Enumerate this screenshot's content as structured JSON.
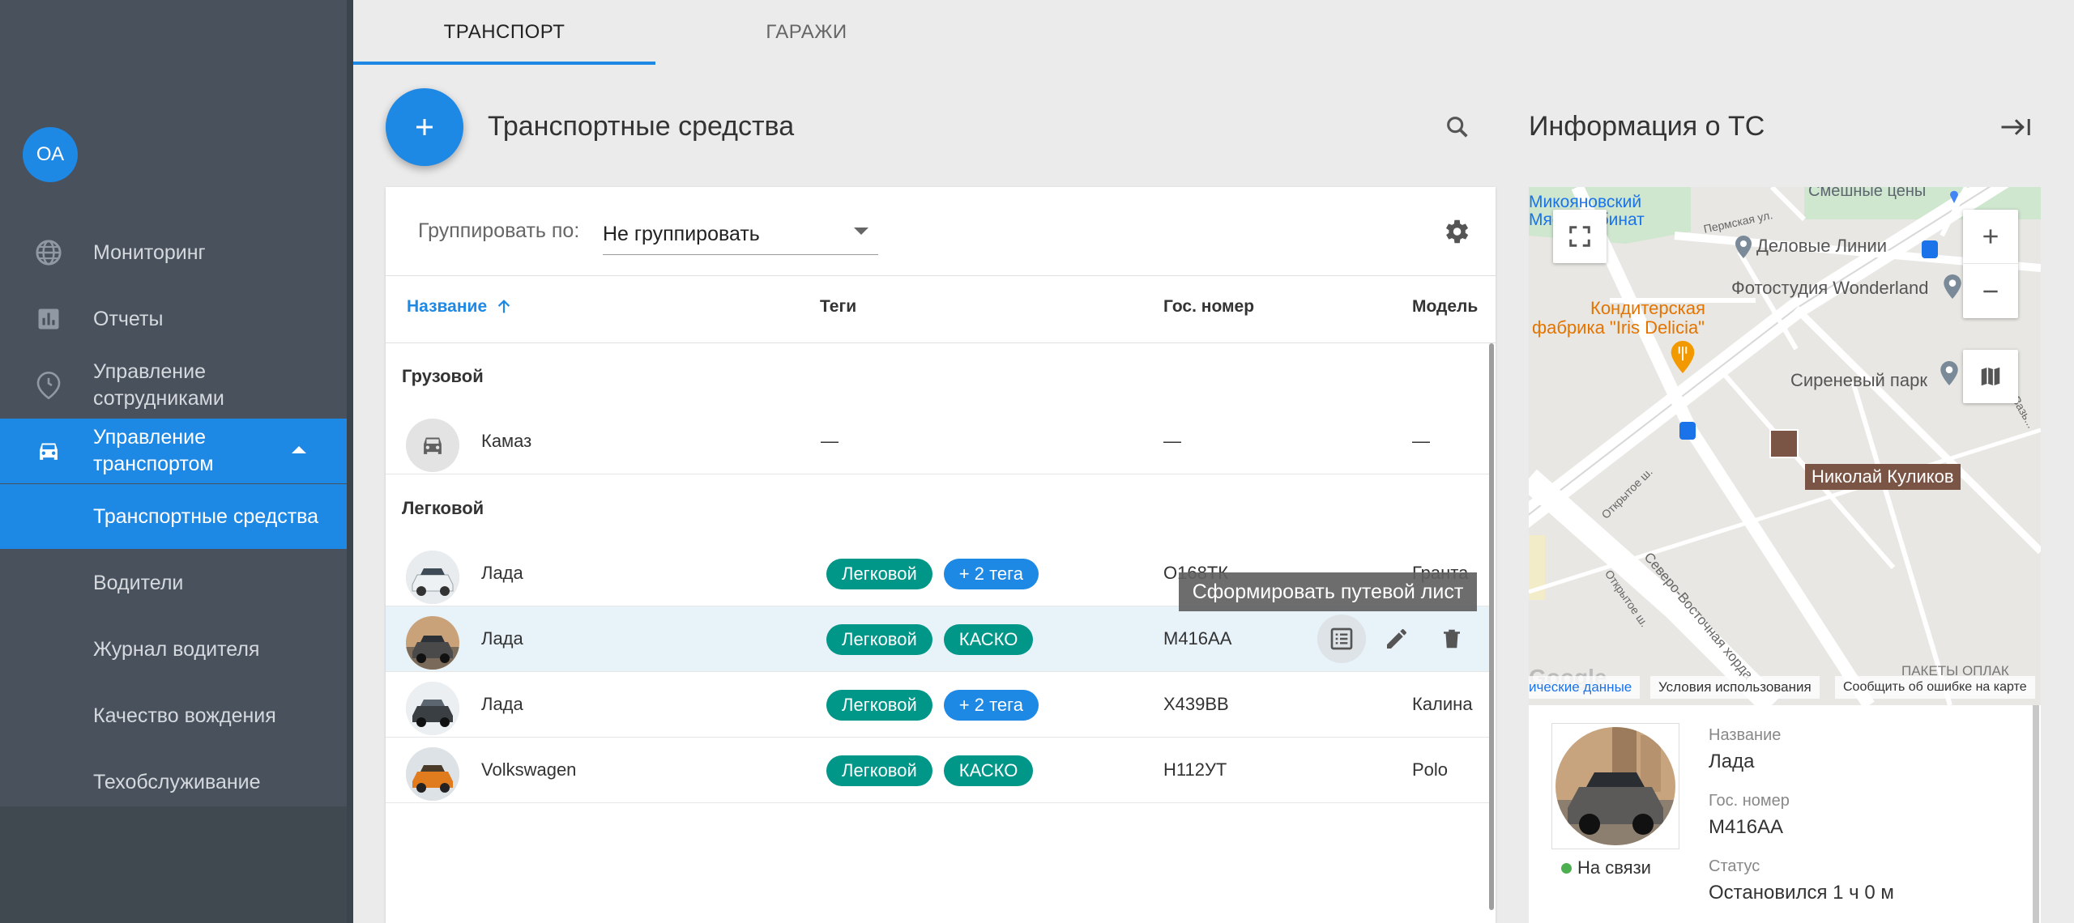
{
  "user": {
    "initials": "ОА"
  },
  "nav": {
    "monitoring": "Мониторинг",
    "reports": "Отчеты",
    "employees_line1": "Управление",
    "employees_line2": "сотрудниками",
    "transport_line1": "Управление",
    "transport_line2": "транспортом",
    "sub_items": [
      "Транспортные средства",
      "Водители",
      "Журнал водителя",
      "Качество вождения",
      "Техобслуживание"
    ]
  },
  "tabs": [
    "ТРАНСПОРТ",
    "ГАРАЖИ"
  ],
  "header": {
    "title": "Транспортные средства",
    "info_title": "Информация о ТС"
  },
  "toolbar": {
    "group_label": "Группировать по:",
    "group_value": "Не группировать"
  },
  "table": {
    "columns": [
      "Название",
      "Теги",
      "Гос. номер",
      "Модель"
    ],
    "groups": [
      {
        "title": "Грузовой",
        "rows": [
          {
            "name": "Камаз",
            "tags": "—",
            "plate": "—",
            "model": "—"
          }
        ]
      },
      {
        "title": "Легковой",
        "rows": [
          {
            "name": "Лада",
            "tag1": "Легковой",
            "tag2": "+ 2 тега",
            "plate": "О168ТК",
            "model": "Гранта"
          },
          {
            "name": "Лада",
            "tag1": "Легковой",
            "tag2": "КАСКО",
            "plate": "М416АА",
            "model": ""
          },
          {
            "name": "Лада",
            "tag1": "Легковой",
            "tag2": "+ 2 тега",
            "plate": "Х439ВВ",
            "model": "Калина"
          },
          {
            "name": "Volkswagen",
            "tag1": "Легковой",
            "tag2": "КАСКО",
            "plate": "Н112УТ",
            "model": "Polo"
          }
        ]
      }
    ],
    "tooltip": "Сформировать путевой лист"
  },
  "map": {
    "labels": {
      "kombinat": "Микояновский",
      "kombinat2": "Мясокомбинат",
      "street1": "Пермская ул.",
      "delovye": "Деловые Линии",
      "foto": "Фотостудия Wonderland",
      "konditer1": "Кондитерская",
      "konditer2": "фабрика \"Iris Delicia\"",
      "siren": "Сиреневый парк",
      "smeshnye": "Смешные цены",
      "otkrytoe": "Открытое ш.",
      "otkrytoe2": "Открытое ш.",
      "sv_hord": "Северо-Восточная хорда",
      "vaz": "Вазь...",
      "google": "Google",
      "paket": "ПАКЕТЫ ОПЛАК"
    },
    "marker_name": "Николай Куликов",
    "attribution": [
      "ические данные",
      "Условия использования",
      "Сообщить об ошибке на карте"
    ]
  },
  "info": {
    "status": "На связи",
    "name_label": "Название",
    "name_value": "Лада",
    "plate_label": "Гос. номер",
    "plate_value": "М416АА",
    "state_label": "Статус",
    "state_value": "Остановился 1 ч 0 м"
  },
  "colors": {
    "accent": "#1e88e5",
    "sidebar": "#48515c",
    "tag_green": "#009688",
    "marker": "#7a5546"
  }
}
